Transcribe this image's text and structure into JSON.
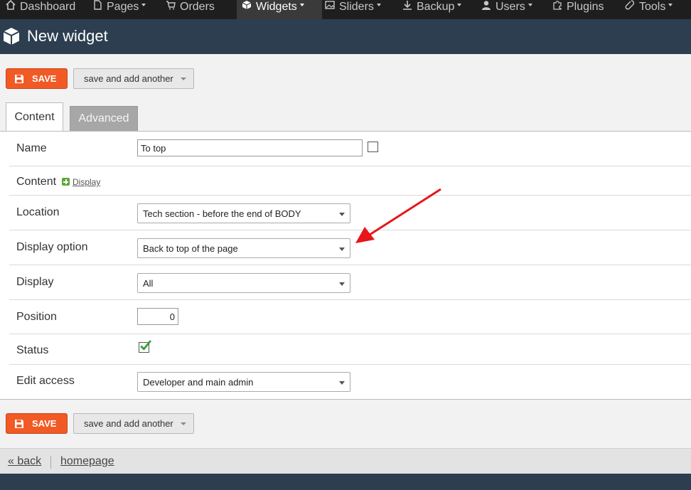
{
  "nav": {
    "items": [
      {
        "label": "Dashboard",
        "icon": "home-icon",
        "caret": false
      },
      {
        "label": "Pages",
        "icon": "page-icon",
        "caret": true
      },
      {
        "label": "Orders",
        "icon": "cart-icon",
        "caret": false
      },
      {
        "label": "Widgets",
        "icon": "cube-icon",
        "caret": true,
        "active": true
      },
      {
        "label": "Sliders",
        "icon": "image-icon",
        "caret": true
      },
      {
        "label": "Backup",
        "icon": "download-icon",
        "caret": true
      },
      {
        "label": "Users",
        "icon": "user-icon",
        "caret": true
      },
      {
        "label": "Plugins",
        "icon": "puzzle-icon",
        "caret": false
      },
      {
        "label": "Tools",
        "icon": "wrench-icon",
        "caret": true
      }
    ]
  },
  "header": {
    "title": "New widget",
    "icon": "cube-icon"
  },
  "toolbar": {
    "save_label": "SAVE",
    "save_another_label": "save and add another"
  },
  "tabs": {
    "content": "Content",
    "advanced": "Advanced"
  },
  "form": {
    "name": {
      "label": "Name",
      "value": "To top"
    },
    "content": {
      "label": "Content",
      "display_link": "Display"
    },
    "location": {
      "label": "Location",
      "value": "Tech section - before the end of BODY"
    },
    "display_option": {
      "label": "Display option",
      "value": "Back to top of the page"
    },
    "display": {
      "label": "Display",
      "value": "All"
    },
    "position": {
      "label": "Position",
      "value": "0"
    },
    "status": {
      "label": "Status",
      "checked": true
    },
    "edit_access": {
      "label": "Edit access",
      "value": "Developer and main admin"
    }
  },
  "footer": {
    "back": "« back",
    "homepage": "homepage"
  },
  "colors": {
    "save": "#f15a24",
    "header": "#2c3e50",
    "nav": "#1e1e1e",
    "arrow": "#e8151b",
    "check": "#2e9e2e"
  }
}
